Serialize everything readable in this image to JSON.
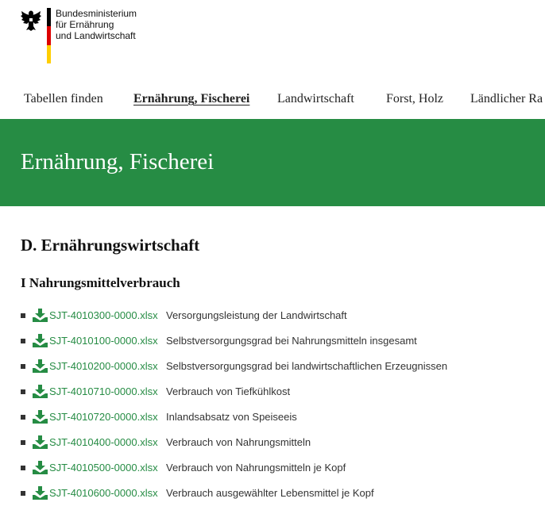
{
  "header": {
    "ministry_lines": [
      "Bundesministerium",
      "für Ernährung",
      "und Landwirtschaft"
    ],
    "flag_colors": [
      "#000000",
      "#dd0000",
      "#ffce00"
    ]
  },
  "nav": {
    "items": [
      {
        "label": "Tabellen finden",
        "active": false
      },
      {
        "label": "Ernährung, Fischerei",
        "active": true
      },
      {
        "label": "Landwirtschaft",
        "active": false
      },
      {
        "label": "Forst, Holz",
        "active": false
      },
      {
        "label": "Ländlicher Ra",
        "active": false
      }
    ]
  },
  "banner": {
    "title": "Ernährung, Fischerei",
    "color": "#268c44"
  },
  "content": {
    "section_title": "D. Ernährungswirtschaft",
    "subsection_title": "I Nahrungsmittelverbrauch",
    "files": [
      {
        "file": "SJT-4010300-0000.xlsx",
        "desc": "Versorgungsleistung der Landwirtschaft"
      },
      {
        "file": "SJT-4010100-0000.xlsx",
        "desc": "Selbstversorgungsgrad bei Nahrungsmitteln insgesamt"
      },
      {
        "file": "SJT-4010200-0000.xlsx",
        "desc": "Selbstversorgungsgrad bei landwirtschaftlichen Erzeugnissen"
      },
      {
        "file": "SJT-4010710-0000.xlsx",
        "desc": "Verbrauch von Tiefkühlkost"
      },
      {
        "file": "SJT-4010720-0000.xlsx",
        "desc": "Inlandsabsatz von Speiseeis"
      },
      {
        "file": "SJT-4010400-0000.xlsx",
        "desc": "Verbrauch von Nahrungsmitteln"
      },
      {
        "file": "SJT-4010500-0000.xlsx",
        "desc": "Verbrauch von Nahrungsmitteln je Kopf"
      },
      {
        "file": "SJT-4010600-0000.xlsx",
        "desc": "Verbrauch ausgewählter Lebensmittel je Kopf"
      }
    ],
    "link_color": "#268c44",
    "icon": "download-icon"
  }
}
